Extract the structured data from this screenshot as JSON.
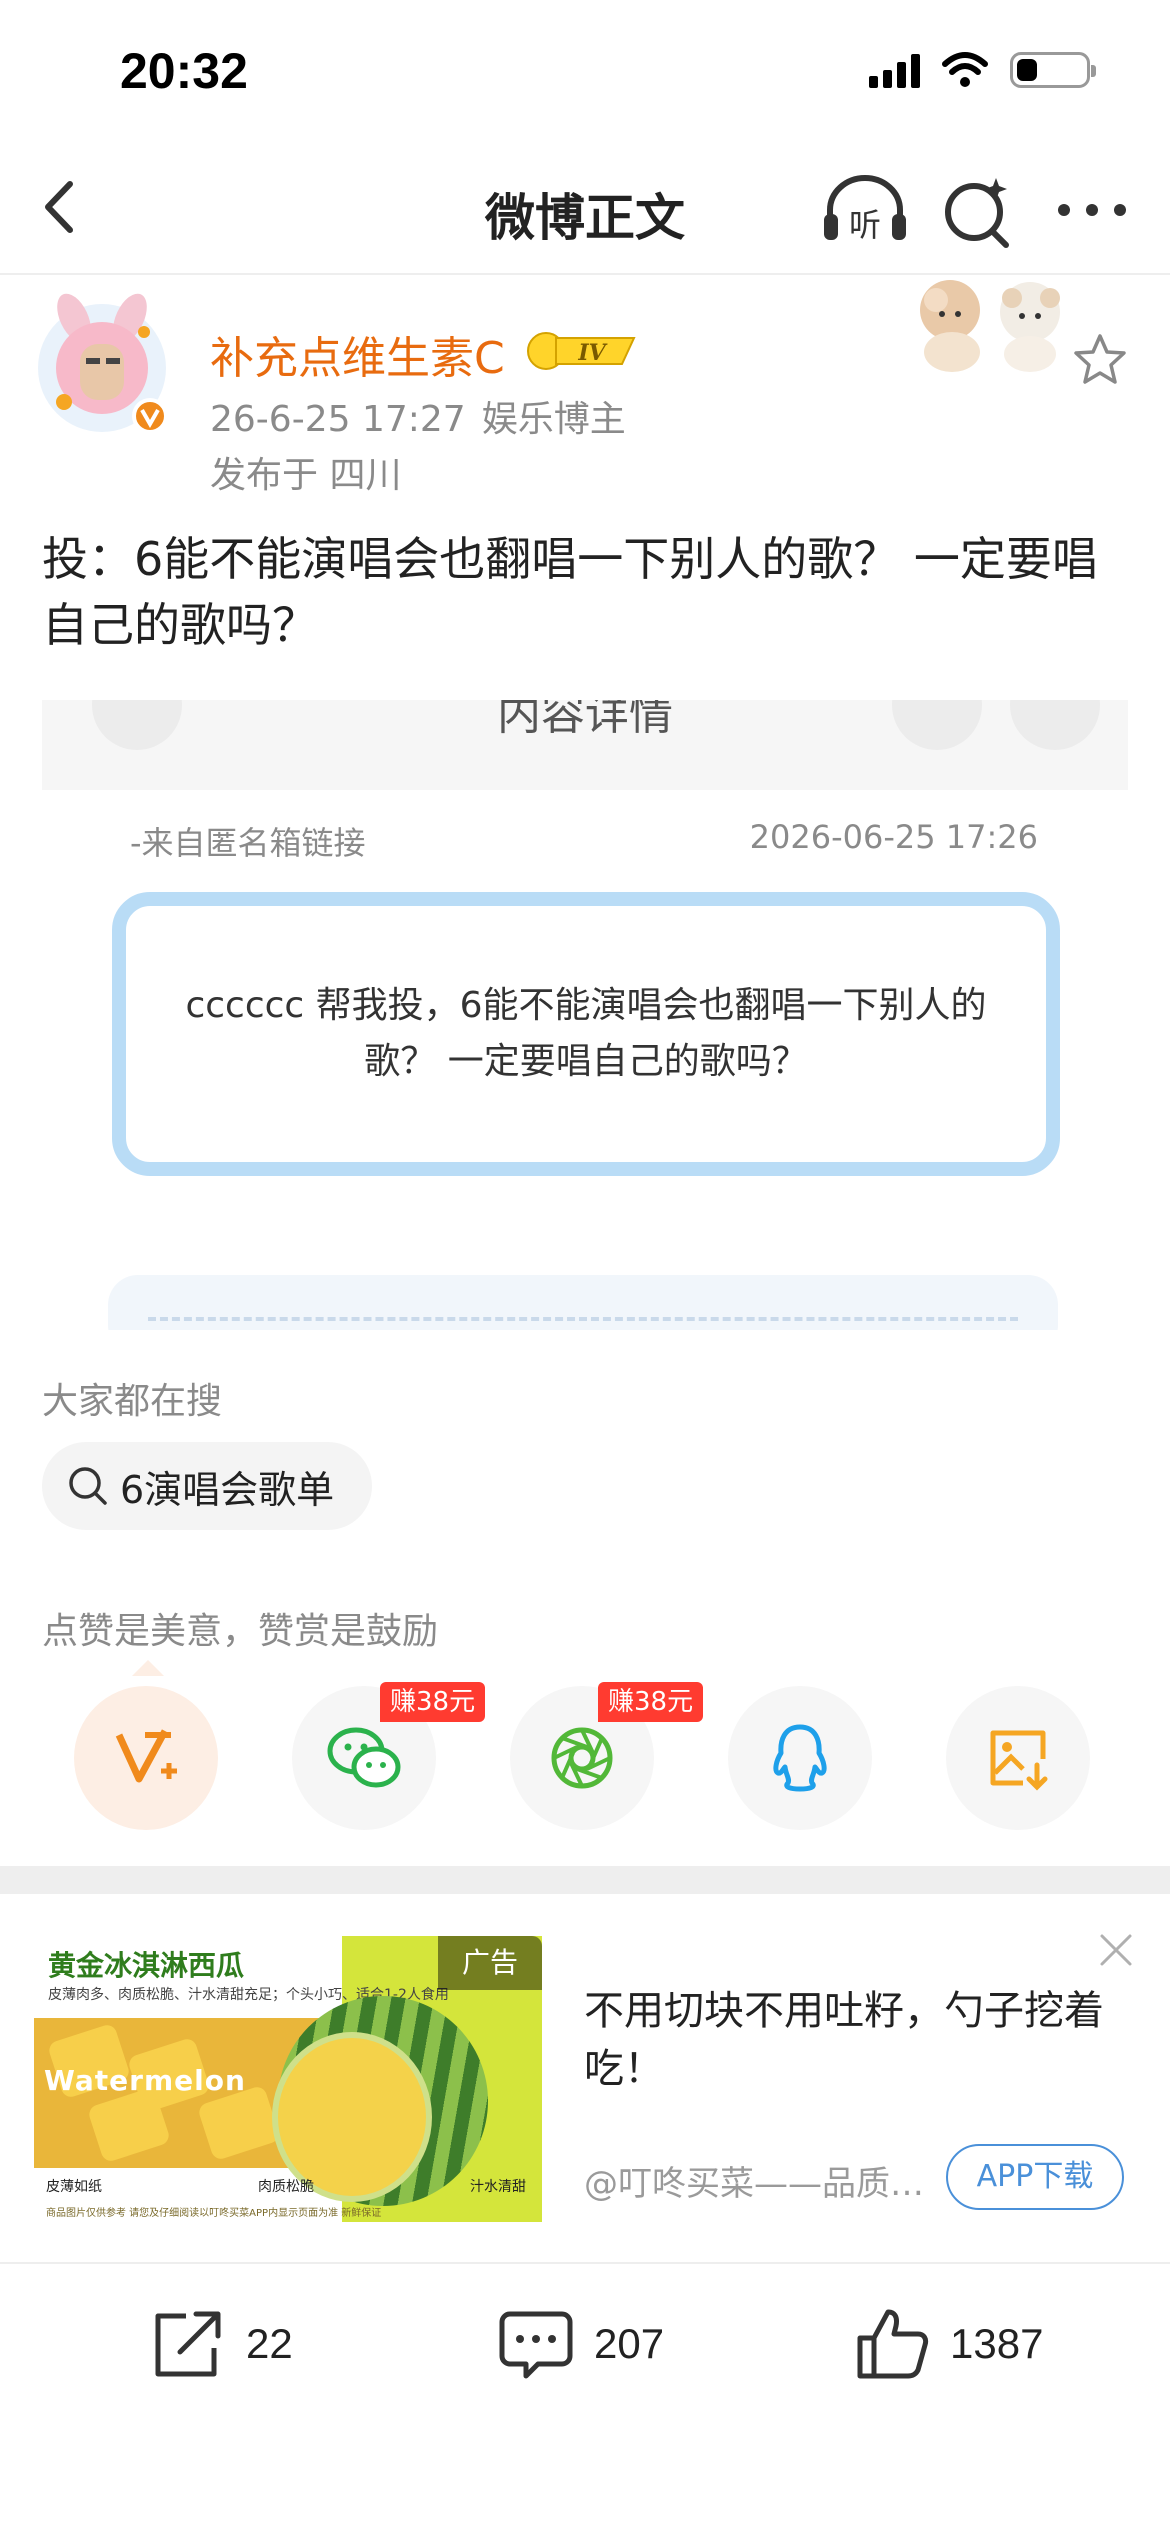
{
  "status_bar": {
    "time": "20:32",
    "battery_level": 0.3
  },
  "nav": {
    "title": "微博正文",
    "listen_label": "听"
  },
  "post": {
    "author": "补充点维生素C",
    "level": "IV",
    "time": "26-6-25 17:27",
    "author_tag": "娱乐博主",
    "location": "发布于 四川",
    "text": "投：6能不能演唱会也翻唱一下别人的歌？ 一定要唱自己的歌吗？"
  },
  "embed": {
    "cut_title": "内容详情",
    "source": "-来自匿名箱链接",
    "date": "2026-06-25 17:26",
    "message": "cccccc 帮我投，6能不能演唱会也翻唱一下别人的歌？ 一定要唱自己的歌吗？"
  },
  "search": {
    "label": "大家都在搜",
    "chip": "6演唱会歌单"
  },
  "reward": {
    "label": "点赞是美意，赞赏是鼓励",
    "share": [
      {
        "name": "vplus",
        "icon": "vplus-icon",
        "badge": ""
      },
      {
        "name": "wechat",
        "icon": "wechat-icon",
        "badge": "赚38元"
      },
      {
        "name": "moments",
        "icon": "moments-icon",
        "badge": "赚38元"
      },
      {
        "name": "qq",
        "icon": "qq-icon",
        "badge": ""
      },
      {
        "name": "save-image",
        "icon": "save-image-icon",
        "badge": ""
      }
    ]
  },
  "ad": {
    "image_title": "黄金冰淇淋西瓜",
    "image_subtitle": "皮薄肉多、肉质松脆、汁水清甜充足；个头小巧、适合1-2人食用",
    "image_en": "Watermelon",
    "image_feats": [
      "皮薄如纸",
      "肉质松脆",
      "汁水清甜"
    ],
    "image_fine": "商品图片仅供参考 请您及仔细阅读以叮咚买菜APP内显示页面为准 新鲜保证",
    "tag": "广告",
    "text": "不用切块不用吐籽，勺子挖着吃！",
    "source": "@叮咚买菜——品质生活，就上叮咚",
    "cta": "APP下载"
  },
  "actions": {
    "repost_count": "22",
    "comment_count": "207",
    "like_count": "1387"
  },
  "colors": {
    "author": "#e86b0f",
    "embed_border": "#b9dcf6",
    "badge_red": "#ff3b30",
    "cta_blue": "#4a90d9"
  }
}
